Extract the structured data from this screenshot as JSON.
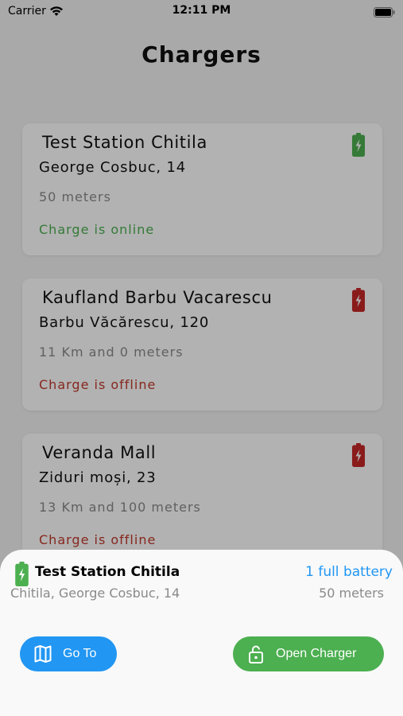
{
  "status_bar": {
    "carrier": "Carrier",
    "time": "12:11 PM"
  },
  "page": {
    "title": "Chargers"
  },
  "chargers": [
    {
      "name": "Test Station Chitila",
      "address": "George Cosbuc, 14",
      "distance": "50 meters",
      "status": "Charge is online",
      "status_color": "#4caf50",
      "battery_color": "#4caf50"
    },
    {
      "name": "Kaufland Barbu Vacarescu",
      "address": "Barbu Văcărescu, 120",
      "distance": "11 Km and 0 meters",
      "status": "Charge is offline",
      "status_color": "#c0392b",
      "battery_color": "#c62828"
    },
    {
      "name": "Veranda Mall",
      "address": "Ziduri moși, 23",
      "distance": "13 Km and 100 meters",
      "status": "Charge is offline",
      "status_color": "#c0392b",
      "battery_color": "#c62828"
    }
  ],
  "sheet": {
    "name": "Test Station Chitila",
    "address": "Chitila, George Cosbuc, 14",
    "battery_count": "1 full battery",
    "distance": "50 meters",
    "goto_label": "Go To",
    "open_label": "Open Charger",
    "colors": {
      "goto": "#2196f3",
      "open": "#4caf50",
      "battery_icon": "#4caf50"
    }
  },
  "icons": [
    "wifi-icon",
    "battery-status-icon",
    "battery-charging-icon",
    "map-icon",
    "unlock-icon"
  ]
}
